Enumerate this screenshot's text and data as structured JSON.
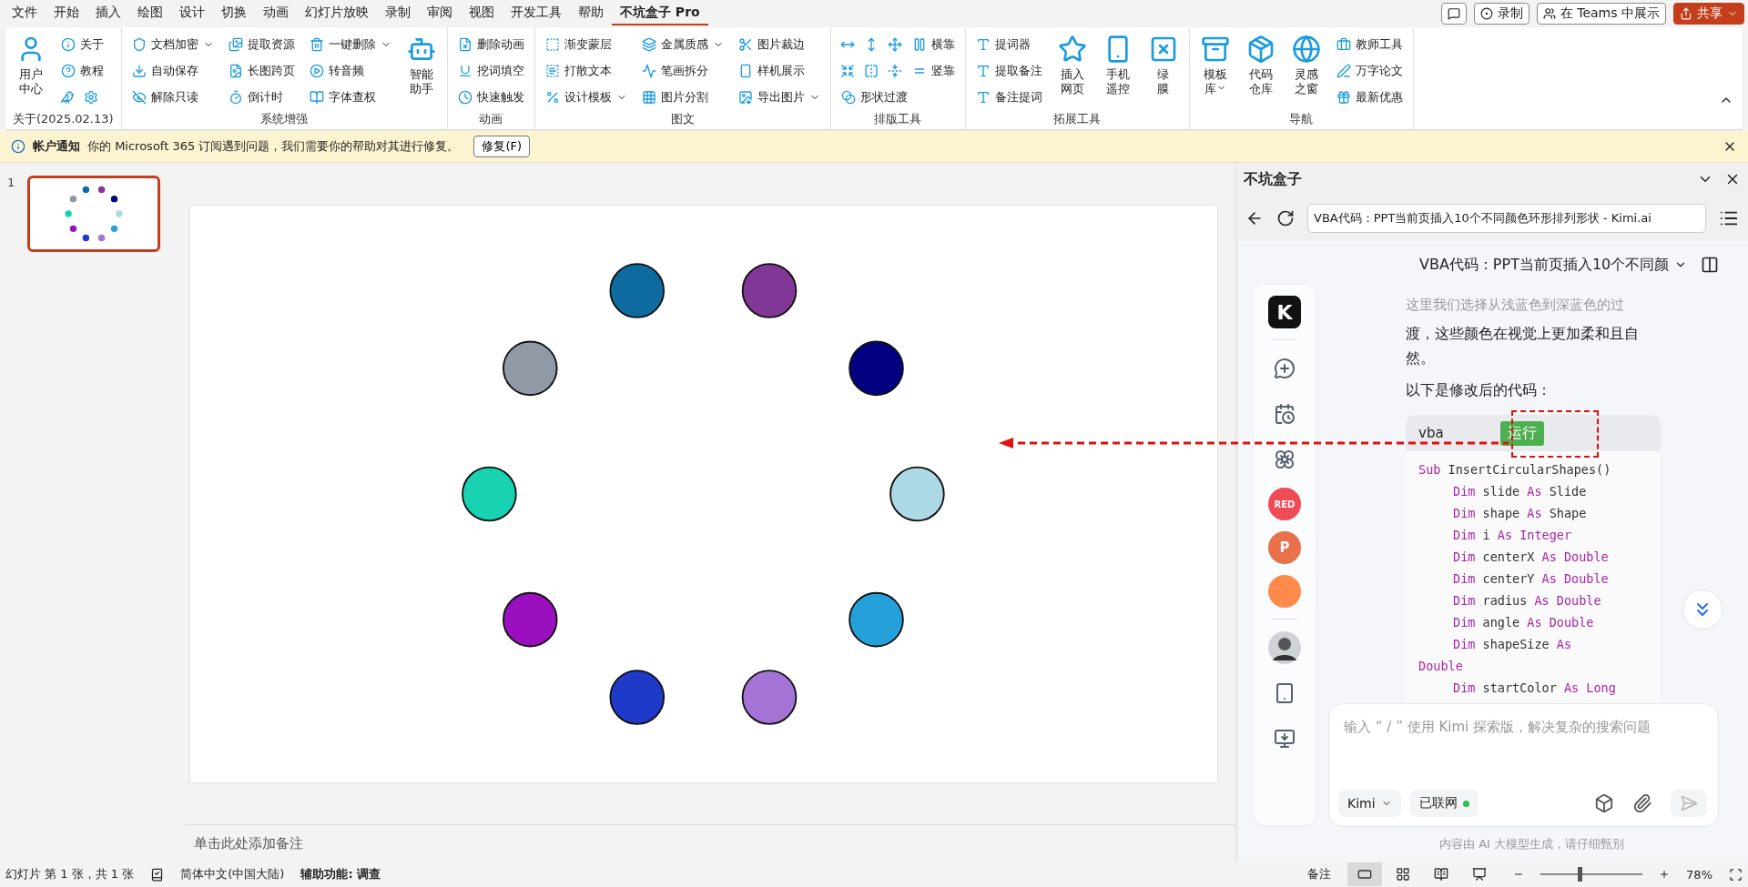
{
  "menu": {
    "tabs": [
      {
        "label": "文件",
        "selected": false
      },
      {
        "label": "开始",
        "selected": false
      },
      {
        "label": "插入",
        "selected": false
      },
      {
        "label": "绘图",
        "selected": false
      },
      {
        "label": "设计",
        "selected": false
      },
      {
        "label": "切换",
        "selected": false
      },
      {
        "label": "动画",
        "selected": false
      },
      {
        "label": "幻灯片放映",
        "selected": false
      },
      {
        "label": "录制",
        "selected": false
      },
      {
        "label": "审阅",
        "selected": false
      },
      {
        "label": "视图",
        "selected": false
      },
      {
        "label": "开发工具",
        "selected": false
      },
      {
        "label": "帮助",
        "selected": false
      },
      {
        "label": "不坑盒子 Pro",
        "selected": true
      }
    ],
    "actions": [
      {
        "kind": "comment"
      },
      {
        "kind": "record",
        "label": "录制"
      },
      {
        "kind": "teams",
        "label": "在 Teams 中展示"
      },
      {
        "kind": "share",
        "label": "共享"
      }
    ]
  },
  "ribbon": {
    "groups": [
      {
        "title": "关于(2025.02.13)",
        "columns": [
          {
            "kind": "large",
            "lines": [
              "用户",
              "中心"
            ]
          },
          {
            "kind": "stack",
            "items": [
              {
                "kind": "small",
                "label": "关于"
              },
              {
                "kind": "small",
                "label": "教程"
              },
              {
                "kind": "row",
                "items": [
                  {
                    "kind": "icon"
                  },
                  {
                    "kind": "icon"
                  }
                ]
              }
            ]
          }
        ]
      },
      {
        "title": "系统增强",
        "columns": [
          {
            "kind": "stack",
            "items": [
              {
                "kind": "small",
                "label": "文档加密",
                "dropdown": true
              },
              {
                "kind": "small",
                "label": "自动保存"
              },
              {
                "kind": "small",
                "label": "解除只读"
              }
            ]
          },
          {
            "kind": "stack",
            "items": [
              {
                "kind": "small",
                "label": "提取资源"
              },
              {
                "kind": "small",
                "label": "长图跨页"
              },
              {
                "kind": "small",
                "label": "倒计时"
              }
            ]
          },
          {
            "kind": "stack",
            "items": [
              {
                "kind": "small",
                "label": "一键删除",
                "dropdown": true
              },
              {
                "kind": "small",
                "label": "转音频"
              },
              {
                "kind": "small",
                "label": "字体查权"
              }
            ]
          },
          {
            "kind": "large",
            "lines": [
              "智能",
              "助手"
            ]
          }
        ]
      },
      {
        "title": "动画",
        "columns": [
          {
            "kind": "stack",
            "items": [
              {
                "kind": "small",
                "label": "删除动画"
              },
              {
                "kind": "small",
                "label": "挖词填空"
              },
              {
                "kind": "small",
                "label": "快速触发"
              }
            ]
          }
        ]
      },
      {
        "title": "图文",
        "columns": [
          {
            "kind": "stack",
            "items": [
              {
                "kind": "small",
                "label": "渐变蒙层"
              },
              {
                "kind": "small",
                "label": "打散文本"
              },
              {
                "kind": "small",
                "label": "设计模板",
                "dropdown": true
              }
            ]
          },
          {
            "kind": "stack",
            "items": [
              {
                "kind": "small",
                "label": "金属质感",
                "dropdown": true
              },
              {
                "kind": "small",
                "label": "笔画拆分"
              },
              {
                "kind": "small",
                "label": "图片分割"
              }
            ]
          },
          {
            "kind": "stack",
            "items": [
              {
                "kind": "small",
                "label": "图片裁边"
              },
              {
                "kind": "small",
                "label": "样机展示"
              },
              {
                "kind": "small",
                "label": "导出图片",
                "dropdown": true
              }
            ]
          }
        ]
      },
      {
        "title": "排版工具",
        "columns": [
          {
            "kind": "stack",
            "items": [
              {
                "kind": "row",
                "items": [
                  {
                    "kind": "icon"
                  },
                  {
                    "kind": "icon"
                  },
                  {
                    "kind": "icon"
                  },
                  {
                    "kind": "small",
                    "label": "横靠"
                  }
                ]
              },
              {
                "kind": "row",
                "items": [
                  {
                    "kind": "icon"
                  },
                  {
                    "kind": "icon"
                  },
                  {
                    "kind": "icon"
                  },
                  {
                    "kind": "small",
                    "label": "竖靠"
                  }
                ]
              },
              {
                "kind": "small",
                "label": "形状过渡"
              }
            ]
          }
        ]
      },
      {
        "title": "拓展工具",
        "columns": [
          {
            "kind": "stack",
            "items": [
              {
                "kind": "small",
                "label": "提词器"
              },
              {
                "kind": "small",
                "label": "提取备注"
              },
              {
                "kind": "small",
                "label": "备注提词"
              }
            ]
          },
          {
            "kind": "large",
            "lines": [
              "插入",
              "网页"
            ]
          },
          {
            "kind": "large",
            "lines": [
              "手机",
              "遥控"
            ]
          },
          {
            "kind": "large",
            "lines": [
              "绿",
              "膜"
            ]
          }
        ]
      },
      {
        "title": "导航",
        "columns": [
          {
            "kind": "large",
            "lines": [
              "模板",
              "库"
            ],
            "dropdown": true
          },
          {
            "kind": "large",
            "lines": [
              "代码",
              "仓库"
            ]
          },
          {
            "kind": "large",
            "lines": [
              "灵感",
              "之窗"
            ]
          },
          {
            "kind": "stack",
            "items": [
              {
                "kind": "small",
                "label": "教师工具"
              },
              {
                "kind": "small",
                "label": "万字论文"
              },
              {
                "kind": "small",
                "label": "最新优惠"
              }
            ]
          }
        ]
      }
    ]
  },
  "notification": {
    "title": "帐户通知",
    "message": "你的 Microsoft 365 订阅遇到问题，我们需要你的帮助对其进行修复。",
    "button": "修复(F)"
  },
  "thumbnails": [
    {
      "number": "1",
      "selected": true
    }
  ],
  "slide": {
    "shapes": [
      {
        "color": "#add8e6"
      },
      {
        "color": "#25a0da"
      },
      {
        "color": "#a374d6"
      },
      {
        "color": "#1f39c9"
      },
      {
        "color": "#9a0fbe"
      },
      {
        "color": "#17d3b2"
      },
      {
        "color": "#9099a5"
      },
      {
        "color": "#0e6b9f"
      },
      {
        "color": "#803795"
      },
      {
        "color": "#000080"
      }
    ]
  },
  "notes": {
    "placeholder": "单击此处添加备注"
  },
  "panel": {
    "title": "不坑盒子",
    "url": "VBA代码：PPT当前页插入10个不同颜色环形排列形状 - Kimi.ai",
    "rail": [
      {
        "kind": "logo",
        "label": "K"
      },
      {
        "kind": "divider"
      },
      {
        "kind": "new-chat"
      },
      {
        "kind": "history"
      },
      {
        "kind": "explore"
      },
      {
        "kind": "app",
        "label": "RED",
        "color": "#f04a55"
      },
      {
        "kind": "app",
        "label": "P",
        "color": "#e8704a"
      },
      {
        "kind": "app",
        "color": "#ff8a4c"
      },
      {
        "kind": "divider"
      },
      {
        "kind": "avatar"
      },
      {
        "kind": "tablet"
      },
      {
        "kind": "download"
      }
    ],
    "chat_title": "VBA代码：PPT当前页插入10个不同颜",
    "faded": "这里我们选择从浅蓝色到深蓝色的过",
    "paragraphs": [
      "渡，这些颜色在视觉上更加柔和且自然。",
      "以下是修改后的代码："
    ],
    "code": {
      "language": "vba",
      "run_button": "运行",
      "lines": [
        {
          "indented": false,
          "tokens": [
            {
              "kind": "keyword",
              "text": "Sub"
            },
            {
              "kind": "text",
              "text": " InsertCircularShapes()"
            }
          ]
        },
        {
          "indented": true,
          "tokens": [
            {
              "kind": "keyword",
              "text": "Dim"
            },
            {
              "kind": "text",
              "text": " slide "
            },
            {
              "kind": "keyword",
              "text": "As"
            },
            {
              "kind": "text",
              "text": " Slide"
            }
          ]
        },
        {
          "indented": true,
          "tokens": [
            {
              "kind": "keyword",
              "text": "Dim"
            },
            {
              "kind": "text",
              "text": " shape "
            },
            {
              "kind": "keyword",
              "text": "As"
            },
            {
              "kind": "text",
              "text": " Shape"
            }
          ]
        },
        {
          "indented": true,
          "tokens": [
            {
              "kind": "keyword",
              "text": "Dim"
            },
            {
              "kind": "text",
              "text": " i "
            },
            {
              "kind": "keyword",
              "text": "As Integer"
            }
          ]
        },
        {
          "indented": true,
          "tokens": [
            {
              "kind": "keyword",
              "text": "Dim"
            },
            {
              "kind": "text",
              "text": " centerX "
            },
            {
              "kind": "keyword",
              "text": "As Double"
            }
          ]
        },
        {
          "indented": true,
          "tokens": [
            {
              "kind": "keyword",
              "text": "Dim"
            },
            {
              "kind": "text",
              "text": " centerY "
            },
            {
              "kind": "keyword",
              "text": "As Double"
            }
          ]
        },
        {
          "indented": true,
          "tokens": [
            {
              "kind": "keyword",
              "text": "Dim"
            },
            {
              "kind": "text",
              "text": " radius "
            },
            {
              "kind": "keyword",
              "text": "As Double"
            }
          ]
        },
        {
          "indented": true,
          "tokens": [
            {
              "kind": "keyword",
              "text": "Dim"
            },
            {
              "kind": "text",
              "text": " angle "
            },
            {
              "kind": "keyword",
              "text": "As Double"
            }
          ]
        },
        {
          "indented": true,
          "tokens": [
            {
              "kind": "keyword",
              "text": "Dim"
            },
            {
              "kind": "text",
              "text": " shapeSize "
            },
            {
              "kind": "keyword",
              "text": "As"
            }
          ]
        },
        {
          "indented": false,
          "tokens": [
            {
              "kind": "keyword",
              "text": "Double"
            }
          ]
        },
        {
          "indented": true,
          "tokens": [
            {
              "kind": "keyword",
              "text": "Dim"
            },
            {
              "kind": "text",
              "text": " startColor "
            },
            {
              "kind": "keyword",
              "text": "As Long"
            }
          ]
        }
      ]
    },
    "input": {
      "placeholder": "输入 “ / ” 使用 Kimi 探索版，解决复杂的搜索问题",
      "model": "Kimi",
      "network": {
        "label": "已联网",
        "on": true
      }
    },
    "disclaimer": "内容由 AI 大模型生成，请仔细甄别"
  },
  "status_bar": {
    "slide_info": "幻灯片 第 1 张，共 1 张",
    "language": "简体中文(中国大陆)",
    "accessibility": "辅助功能: 调查",
    "notes": "备注",
    "views": [
      {
        "kind": "normal",
        "selected": true
      },
      {
        "kind": "sorter",
        "selected": false
      },
      {
        "kind": "reading",
        "selected": false
      },
      {
        "kind": "show",
        "selected": false
      }
    ],
    "zoom": {
      "level": 0.38,
      "reading": "78%"
    }
  }
}
